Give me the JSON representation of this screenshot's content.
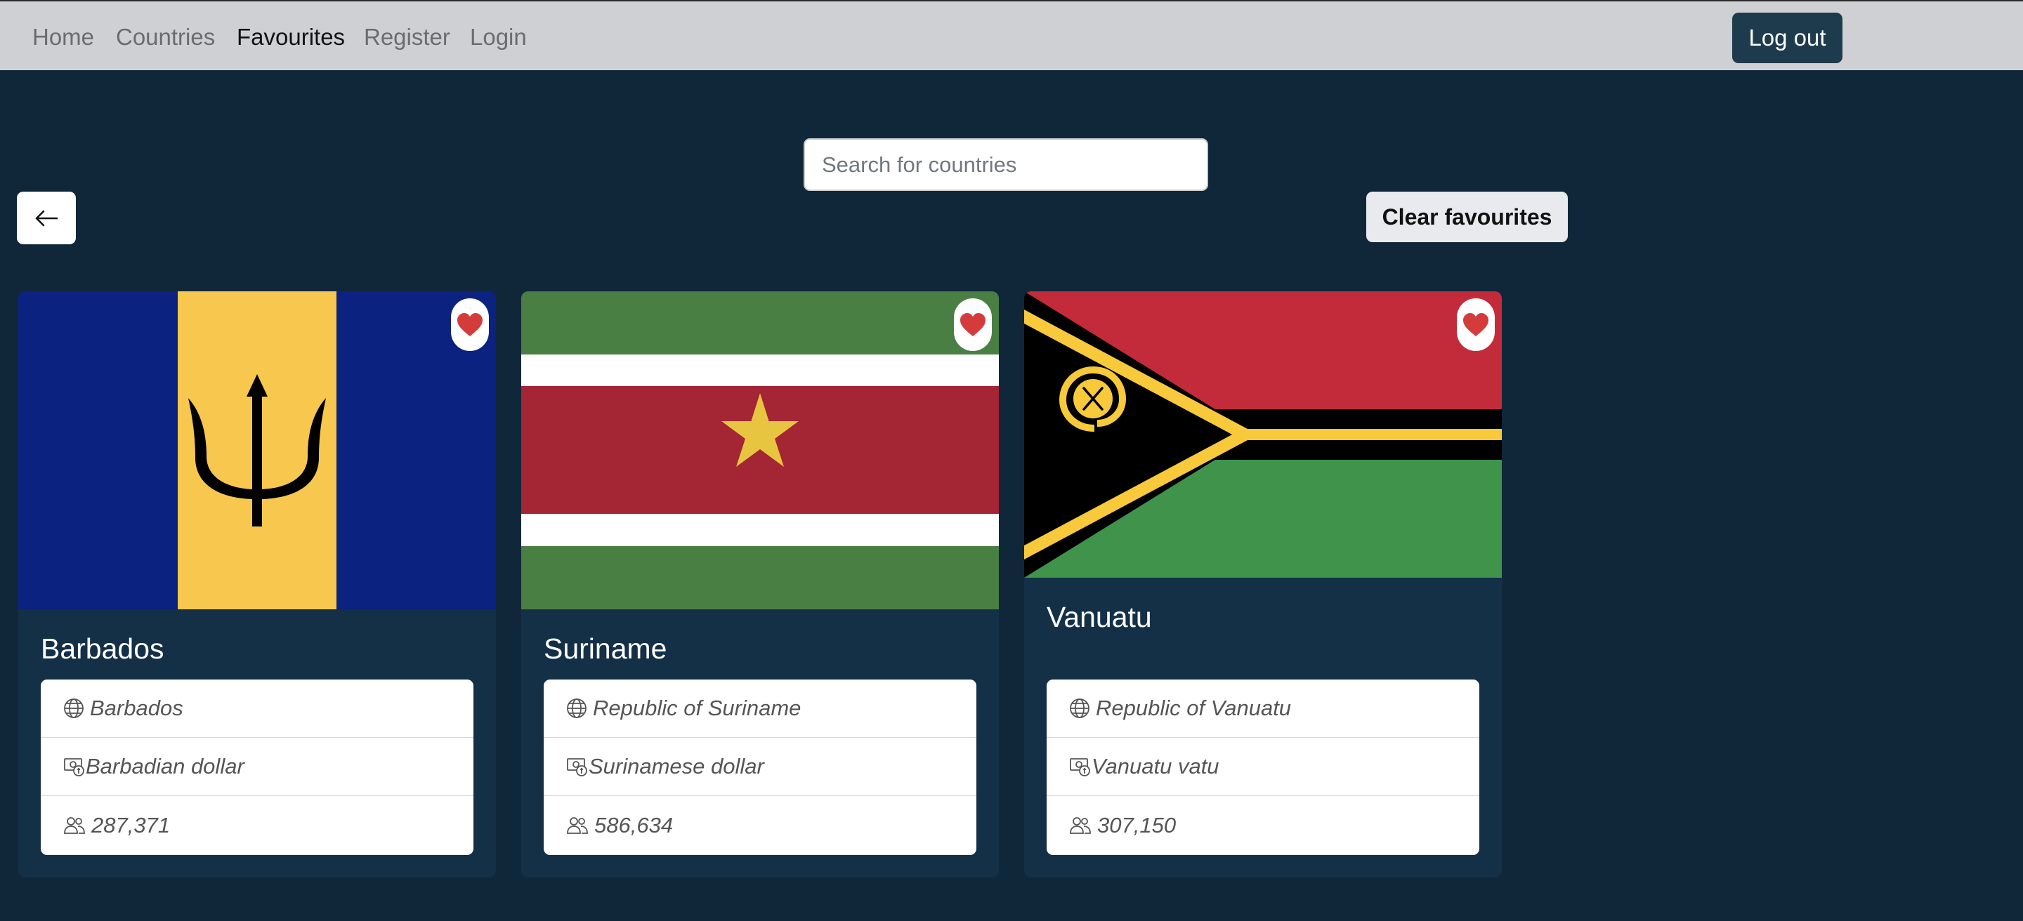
{
  "nav": {
    "items": [
      {
        "label": "Home"
      },
      {
        "label": "Countries"
      },
      {
        "label": "Favourites"
      },
      {
        "label": "Register"
      },
      {
        "label": "Login"
      }
    ],
    "logout_label": "Log out"
  },
  "search": {
    "placeholder": "Search for countries",
    "value": ""
  },
  "back_button": {
    "icon": "arrow-left-icon"
  },
  "clear_label": "Clear favourites",
  "cards": [
    {
      "name": "Barbados",
      "official_name": "Barbados",
      "currency": "Barbadian dollar",
      "population": "287,371",
      "favourite": true,
      "flag_colors": [
        "#0b2280",
        "#f7c74e",
        "#000000"
      ]
    },
    {
      "name": "Suriname",
      "official_name": "Republic of Suriname",
      "currency": "Surinamese dollar",
      "population": "586,634",
      "favourite": true,
      "flag_colors": [
        "#4a7f44",
        "#ffffff",
        "#a42534",
        "#e8c540"
      ]
    },
    {
      "name": "Vanuatu",
      "official_name": "Republic of Vanuatu",
      "currency": "Vanuatu vatu",
      "population": "307,150",
      "favourite": true,
      "flag_colors": [
        "#c42b3a",
        "#000000",
        "#f7c93b",
        "#3f934b"
      ]
    }
  ],
  "icons": {
    "official_name": "globe-icon",
    "currency": "cash-coin-icon",
    "population": "people-icon",
    "favourite": "heart-icon"
  },
  "colors": {
    "background": "#10273a",
    "navbar": "#cfd0d4",
    "card": "#143047",
    "logout": "#1e3b4d",
    "heart": "#d43c3c"
  }
}
